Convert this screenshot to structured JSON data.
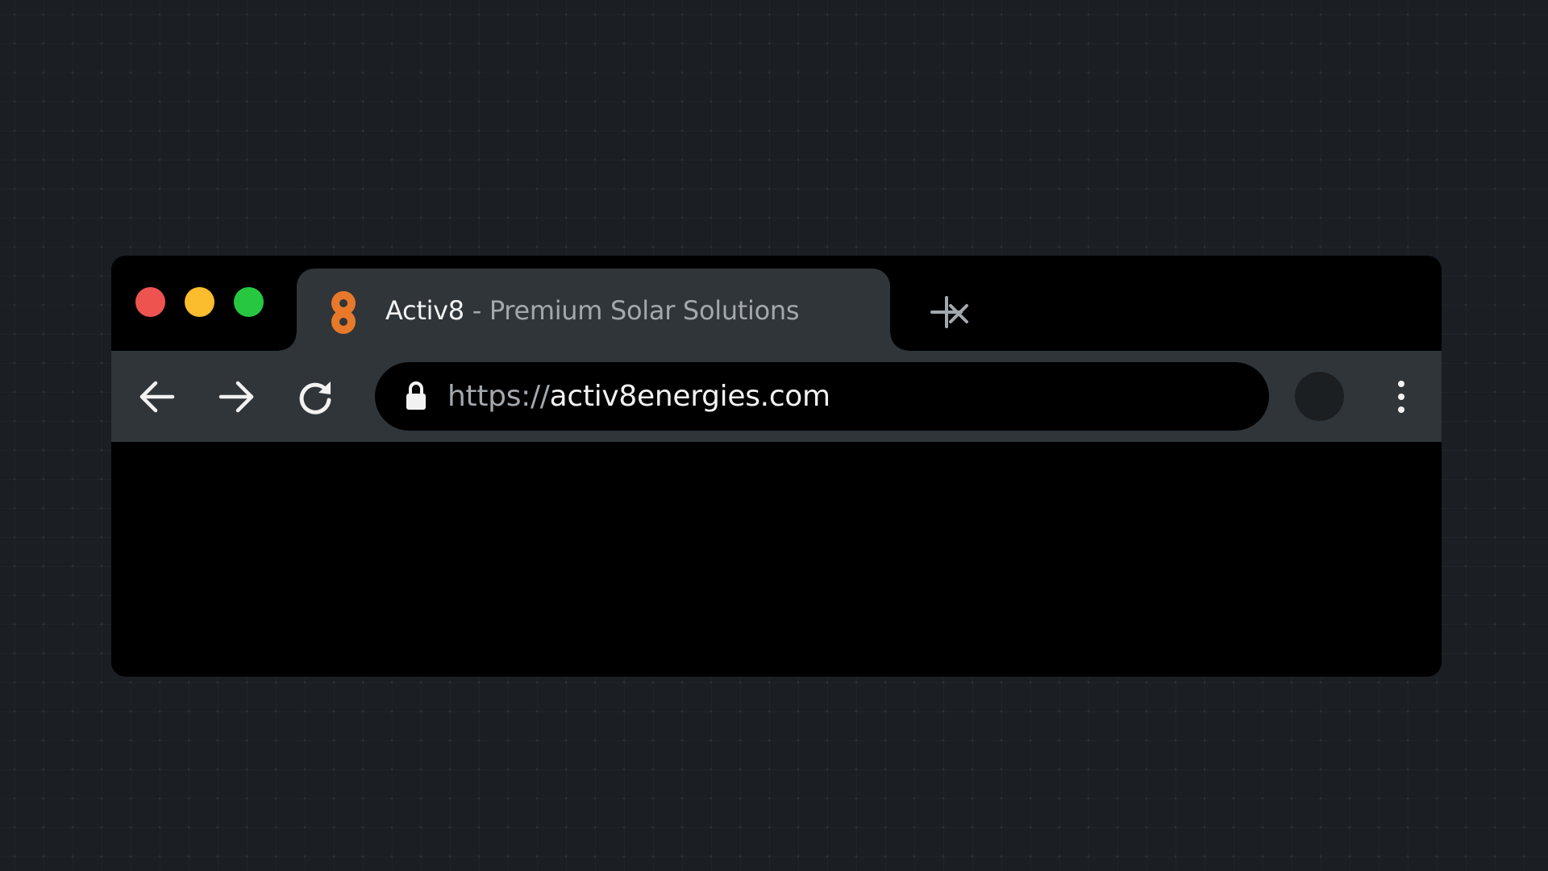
{
  "window": {
    "traffic_lights": {
      "close_color": "#ef5350",
      "minimize_color": "#fbbc2e",
      "maximize_color": "#27c840"
    }
  },
  "tab": {
    "site_name": "Activ8",
    "title_rest": " - Premium Solar Solutions",
    "favicon": "activ8-logo",
    "favicon_color": "#e8792a",
    "close_icon": "close-icon"
  },
  "toolbar": {
    "back_icon": "arrow-left-icon",
    "forward_icon": "arrow-right-icon",
    "reload_icon": "reload-icon",
    "menu_icon": "more-vertical-icon",
    "new_tab_icon": "plus-icon"
  },
  "address_bar": {
    "scheme": "https://",
    "host": "activ8energies.com",
    "lock_icon": "lock-icon"
  },
  "colors": {
    "background": "#1b1e23",
    "chrome": "#303539",
    "frame": "#000000",
    "text_primary": "#f2f2f2",
    "text_secondary": "#a3a8ad"
  }
}
